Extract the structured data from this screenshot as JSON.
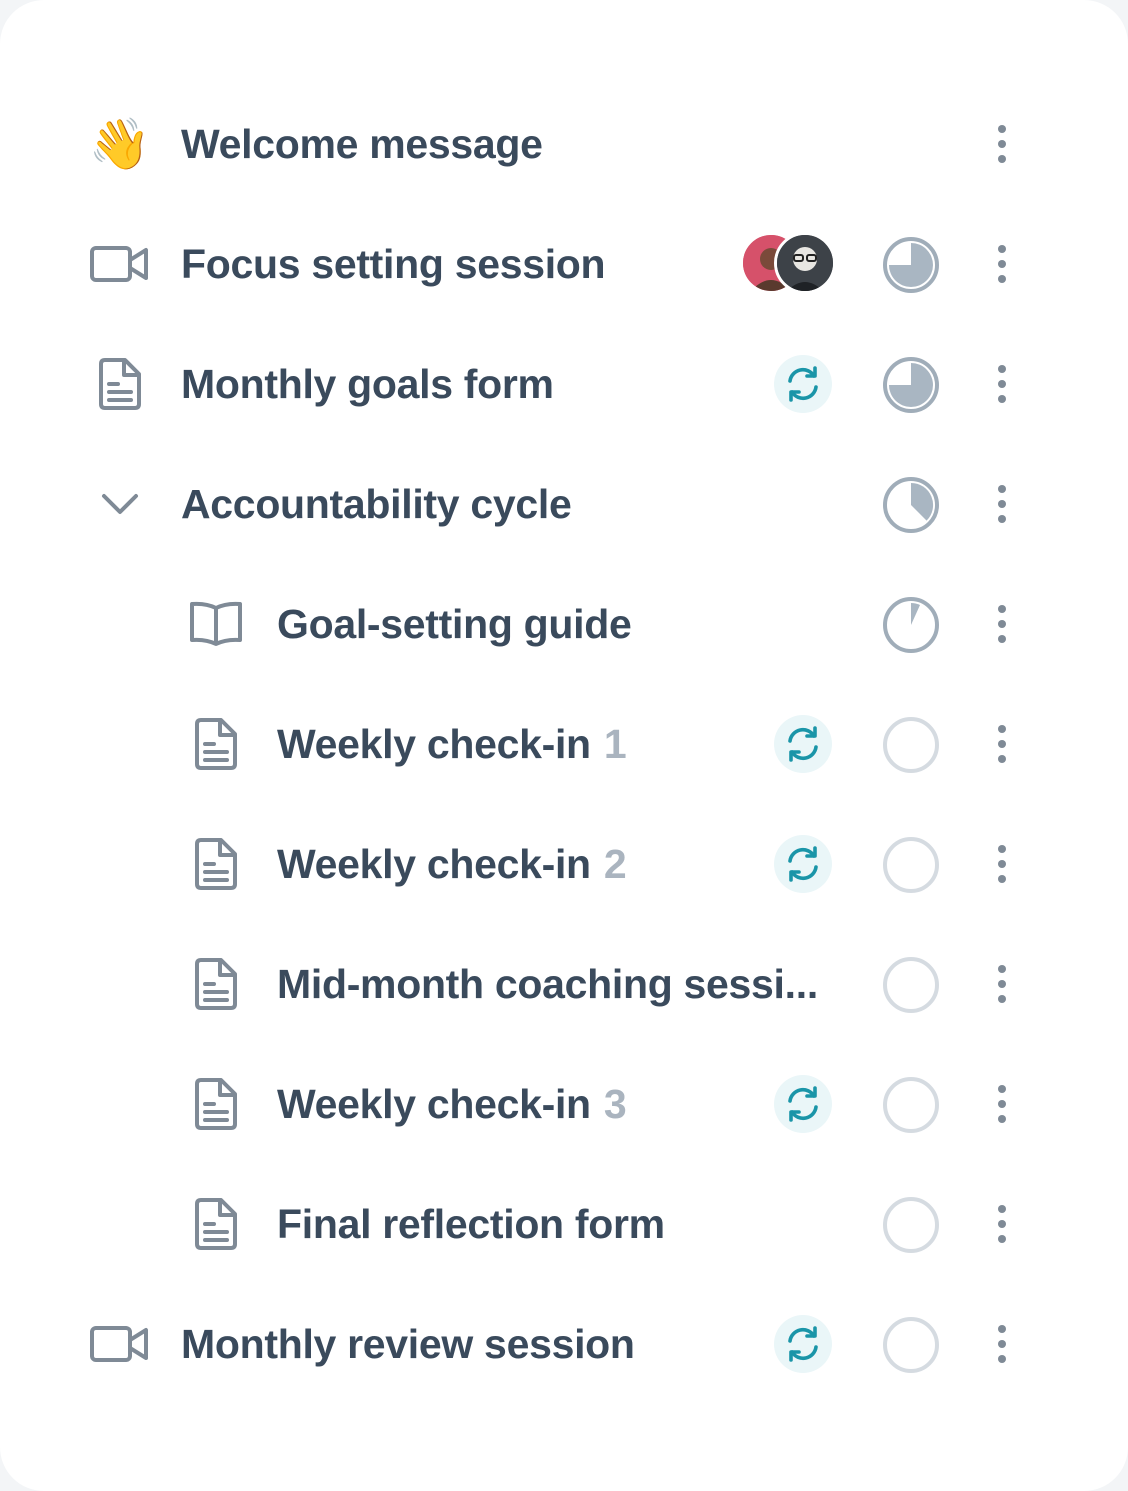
{
  "items": [
    {
      "icon": "waving-hand-icon",
      "emoji": "👋",
      "label": "Welcome message",
      "num": "",
      "sync": false,
      "avatars": false,
      "progress": null
    },
    {
      "icon": "video-camera-icon",
      "label": "Focus setting session",
      "num": "",
      "sync": false,
      "avatars": true,
      "progress": 0.75
    },
    {
      "icon": "document-icon",
      "label": "Monthly goals form",
      "num": "",
      "sync": true,
      "avatars": false,
      "progress": 0.75
    },
    {
      "icon": "chevron-down-icon",
      "label": "Accountability cycle",
      "num": "",
      "sync": false,
      "avatars": false,
      "progress": 0.375
    },
    {
      "icon": "book-icon",
      "label": "Goal-setting guide",
      "num": "",
      "sync": false,
      "avatars": false,
      "progress": 0.08
    },
    {
      "icon": "document-icon",
      "label": "Weekly check-in",
      "num": "1",
      "sync": true,
      "avatars": false,
      "progress": 0
    },
    {
      "icon": "document-icon",
      "label": "Weekly check-in",
      "num": "2",
      "sync": true,
      "avatars": false,
      "progress": 0
    },
    {
      "icon": "document-icon",
      "label": "Mid-month coaching sessi...",
      "num": "",
      "sync": false,
      "avatars": false,
      "progress": 0
    },
    {
      "icon": "document-icon",
      "label": "Weekly check-in",
      "num": "3",
      "sync": true,
      "avatars": false,
      "progress": 0
    },
    {
      "icon": "document-icon",
      "label": "Final reflection form",
      "num": "",
      "sync": false,
      "avatars": false,
      "progress": 0
    },
    {
      "icon": "video-camera-icon",
      "label": "Monthly review session",
      "num": "",
      "sync": true,
      "avatars": false,
      "progress": 0
    }
  ],
  "colors": {
    "text": "#3a4a5c",
    "muted_number": "#aab4bf",
    "icon_gray": "#7f8a96",
    "progress_stroke": "#a0adb9",
    "progress_fill": "#a9b6c2",
    "empty_circle": "#d5dbe1",
    "sync_teal": "#1a95a8",
    "sync_bg": "#eaf6f8"
  }
}
